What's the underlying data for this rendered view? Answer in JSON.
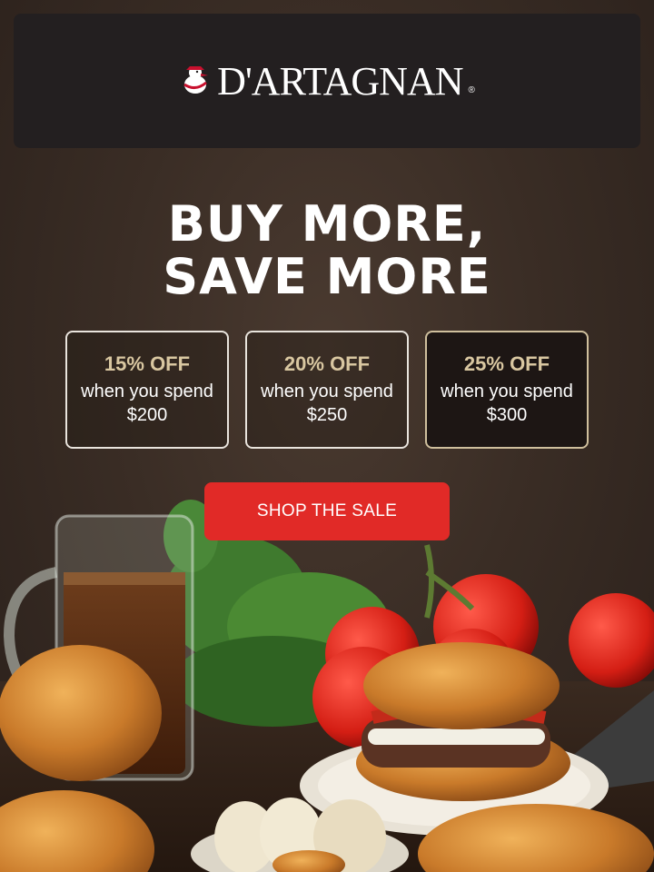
{
  "brand": {
    "name": "D'ARTAGNAN",
    "registered": "®"
  },
  "hero": {
    "headline_line1": "BUY MORE,",
    "headline_line2": "SAVE MORE"
  },
  "tiers": [
    {
      "discount": "15% OFF",
      "condition": "when you spend $200"
    },
    {
      "discount": "20% OFF",
      "condition": "when you spend $250"
    },
    {
      "discount": "25% OFF",
      "condition": "when you spend $300"
    }
  ],
  "cta": {
    "label": "SHOP THE SALE"
  },
  "colors": {
    "header_bg": "#231f20",
    "cta_red": "#e12a27",
    "discount_gold": "#d9c7a1",
    "tier_border_highlight": "#cfbf9d"
  }
}
